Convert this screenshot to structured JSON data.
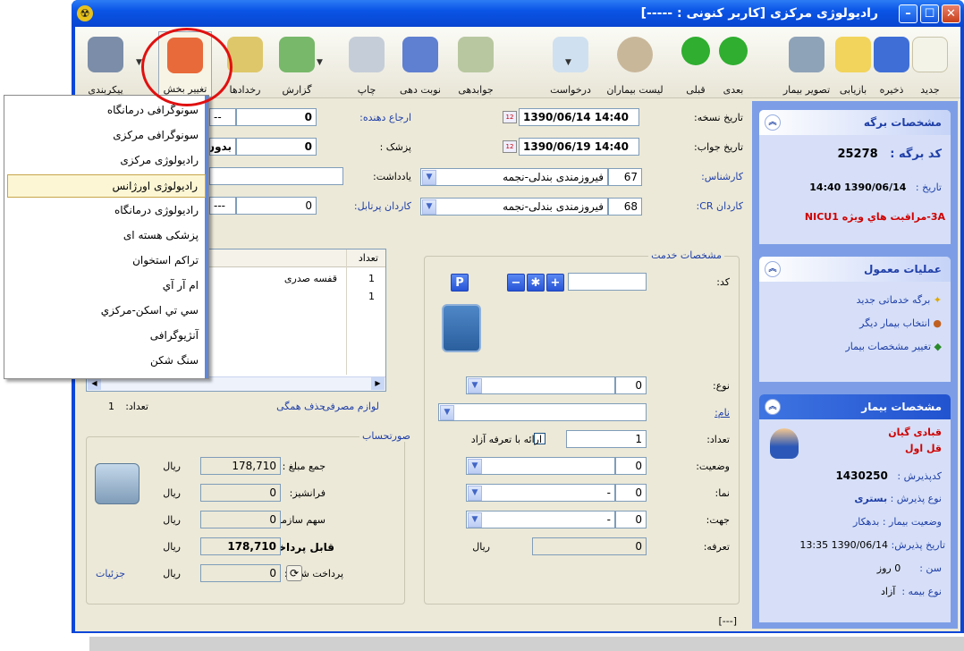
{
  "window": {
    "title": "رادیولوژی مرکزی [کاربر کنونی : -----]",
    "status": "[---]",
    "accent": "#0a46d8"
  },
  "toolbar": {
    "buttons": [
      {
        "label": "جدید",
        "icon": "new-document-icon"
      },
      {
        "label": "ذخیره",
        "icon": "save-icon"
      },
      {
        "label": "بازیابی",
        "icon": "open-folder-icon"
      },
      {
        "label": "تصویر بیمار",
        "icon": "camera-icon"
      },
      {
        "label": "بعدی",
        "icon": "next-arrow-icon"
      },
      {
        "label": "قبلی",
        "icon": "previous-arrow-icon"
      },
      {
        "label": "لیست بیماران",
        "icon": "search-icon"
      },
      {
        "label": "درخواست",
        "icon": "request-icon"
      },
      {
        "label": "جوابدهی",
        "icon": "report-icon"
      },
      {
        "label": "نوبت دهی",
        "icon": "calendar-clock-icon"
      },
      {
        "label": "چاپ",
        "icon": "print-icon"
      },
      {
        "label": "گزارش",
        "icon": "chart-icon"
      },
      {
        "label": "رخدادها",
        "icon": "key-icon"
      },
      {
        "label": "تغییر بخش",
        "icon": "change-department-icon"
      },
      {
        "label": "پیکربندی",
        "icon": "settings-icon"
      }
    ]
  },
  "dropdown_menu": {
    "items": [
      "سونوگرافی درمانگاه",
      "سونوگرافی مرکزی",
      "رادیولوژی مرکزی",
      "رادیولوژی اورژانس",
      "رادیولوژی درمانگاه",
      "پزشکی هسته ای",
      "تراکم استخوان",
      "ام آر آي",
      "سي تي اسکن-مرکزي",
      "آنژیوگرافی",
      "سنگ شکن"
    ],
    "selected_index": 3
  },
  "form": {
    "issue_date_label": "تاریخ نسخه:",
    "issue_date": "1390/06/14 14:40",
    "answer_date_label": "تاریخ جواب:",
    "answer_date": "1390/06/19 14:40",
    "expert_label": "کارشناس:",
    "expert_code": "67",
    "expert_name": "فیروزمندی بندلی-نجمه",
    "cr_label": "کاردان CR:",
    "cr_code": "68",
    "cr_name": "فیروزمندی بندلی-نجمه",
    "referrer_label": "ارجاع دهنده:",
    "referrer_code": "0",
    "referrer_name": "--",
    "doctor_label": "پزشک :",
    "doctor_code": "0",
    "doctor_name": "بدون پز",
    "note_label": "يادداشت:",
    "portable_label": "کاردان پرتابل:",
    "portable_code": "0",
    "portable_name": "---"
  },
  "service": {
    "group_title": "مشخصات خدمت",
    "code_label": "کد:",
    "type_label": "نوع:",
    "type_value": "0",
    "name_label": "نام:",
    "count_label": "تعداد:",
    "count_value": "1",
    "free_tariff_label": "ارائه با تعرفه آزاد",
    "status_label": "وضعیت:",
    "status_value": "0",
    "view_label": "نما:",
    "view_value": "0",
    "view_text": "-",
    "direction_label": "جهت:",
    "direction_value": "0",
    "direction_text": "-",
    "tariff_label": "تعرفه:",
    "tariff_value": "0",
    "currency": "ریال",
    "p_button": "P"
  },
  "consumables": {
    "header_count": "تعداد",
    "rows": [
      {
        "count": "1",
        "name": "قفسه صدری"
      },
      {
        "count": "1",
        "name": ""
      }
    ],
    "footer_count_label": "تعداد:",
    "footer_count": "1",
    "link_consumables": "لوازم مصرفی",
    "link_delete_all": "حذف همگی"
  },
  "billing": {
    "group_title": "صورتحساب",
    "total_label": "جمع مبلغ :",
    "total": "178,710",
    "franchise_label": "فرانشیز:",
    "franchise": "0",
    "org_share_label": "سهم سازمان :",
    "org_share": "0",
    "payable_label": "قابل پرداخت :",
    "payable": "178,710",
    "paid_label": "پرداخت شده :",
    "paid": "0",
    "details_link": "جزئیات",
    "currency": "ریال"
  },
  "sidebar": {
    "sheet_panel": {
      "title": "مشخصات برگه",
      "code_label": "کد برگه :",
      "code": "25278",
      "date_label": "تاریخ :",
      "date": "1390/06/14 14:40",
      "ward": "3A-مراقبت هاي ويژه NICU1"
    },
    "ops_panel": {
      "title": "عملیات معمول",
      "items": [
        "برگه خدماتی جدید",
        "انتخاب بیمار دیگر",
        "تغییر مشخصات بیمار"
      ]
    },
    "patient_panel": {
      "title": "مشخصات بیمار",
      "name1": "قبادی گیان",
      "name2": "قل اول",
      "admission_code_label": "کدپذیرش :",
      "admission_code": "1430250",
      "admission_type_label": "نوع پذیرش :",
      "admission_type": "بستری",
      "status_label": "وضعیت بیمار :",
      "status": "بدهکار",
      "admission_date_label": "تاریخ پذیرش:",
      "admission_date": "1390/06/14 13:35",
      "age_label": "سن :",
      "age": "0 روز",
      "insurance_label": "نوع بیمه :",
      "insurance": "آزاد"
    }
  }
}
